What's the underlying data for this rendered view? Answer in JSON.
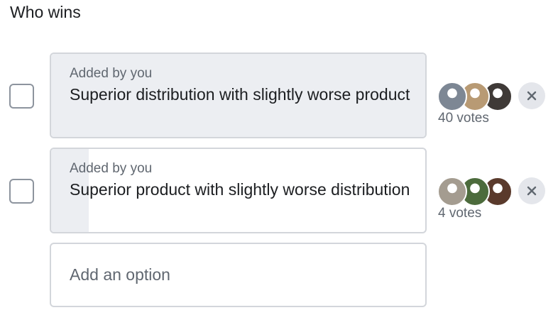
{
  "poll": {
    "question": "Who wins",
    "options": [
      {
        "added_by": "Added by you",
        "label": "Superior distribution with slightly worse product",
        "votes_label": "40 votes",
        "vote_share": 1.0,
        "voter_avatars": [
          "avatar-voter",
          "avatar-voter",
          "avatar-voter"
        ],
        "avatar_colors": [
          "#7d8794",
          "#b89a74",
          "#3f3a37"
        ]
      },
      {
        "added_by": "Added by you",
        "label": "Superior product with slightly worse distribution",
        "votes_label": "4 votes",
        "vote_share": 0.1,
        "voter_avatars": [
          "avatar-voter",
          "avatar-voter",
          "avatar-voter"
        ],
        "avatar_colors": [
          "#a49c90",
          "#4c6b3c",
          "#5a3a2c"
        ]
      }
    ],
    "add_option": {
      "placeholder": "Add an option"
    }
  },
  "colors": {
    "fill": "#eceef2",
    "border": "#d3d6db",
    "secondary_text": "#606770",
    "remove_button_bg": "#e4e6eb"
  },
  "icons": {
    "remove": "close-icon",
    "checkbox": "checkbox-icon"
  }
}
